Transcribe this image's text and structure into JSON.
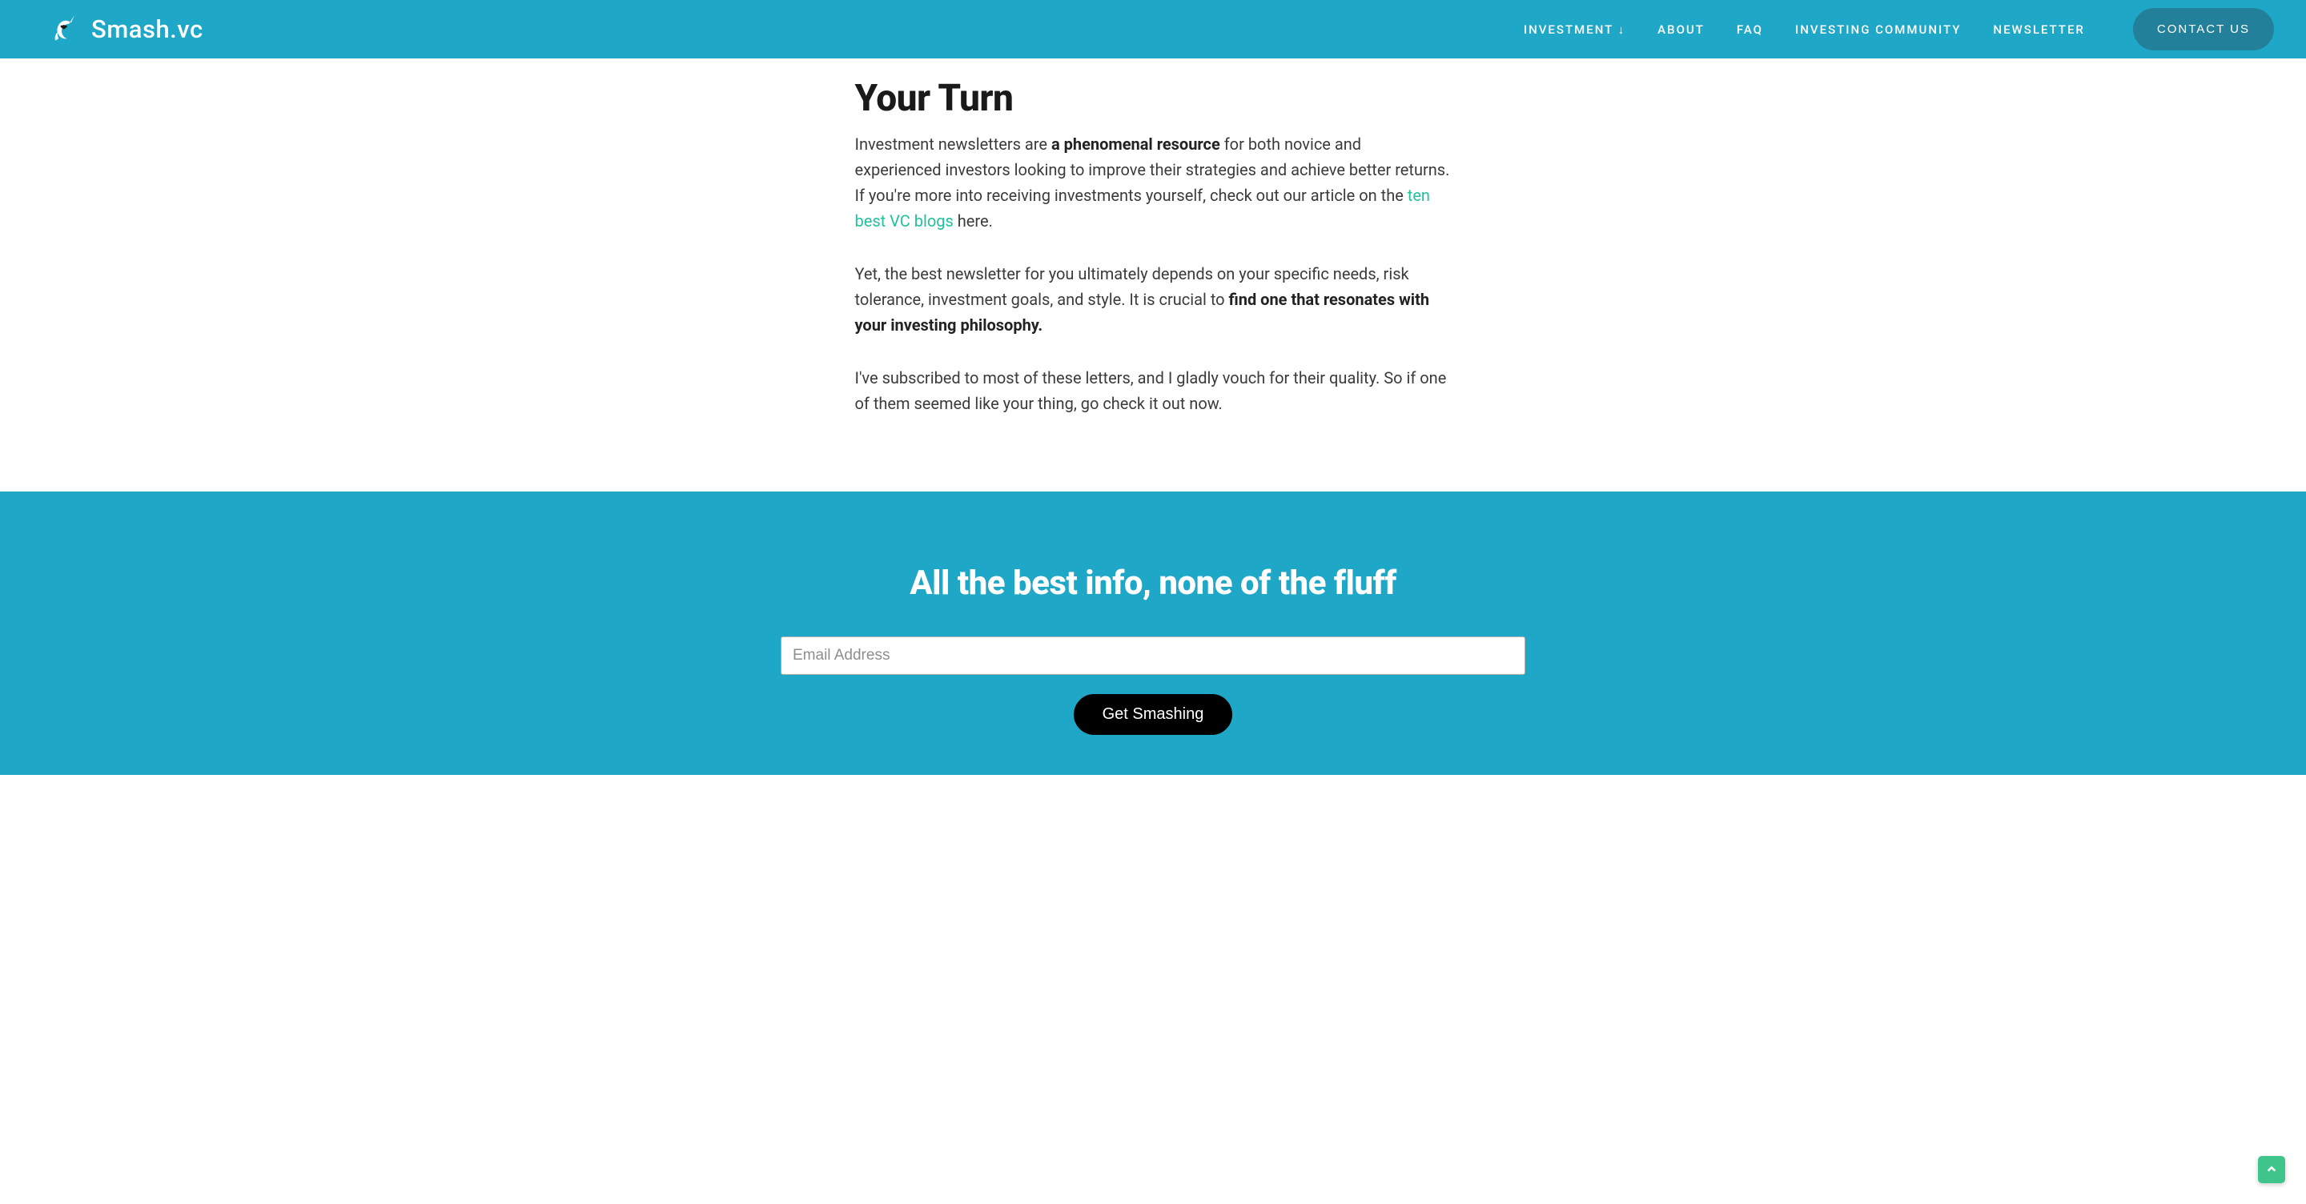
{
  "brand": {
    "name": "Smash.vc"
  },
  "nav": {
    "items": [
      "INVESTMENT ↓",
      "ABOUT",
      "FAQ",
      "INVESTING COMMUNITY",
      "NEWSLETTER"
    ],
    "contact": "CONTACT US"
  },
  "article": {
    "heading": "Your Turn",
    "p1_a": "Investment newsletters are ",
    "p1_strong": "a phenomenal resource",
    "p1_b": " for both novice and experienced investors looking to improve their strategies and achieve better returns. If you're more into receiving investments yourself, check out our article on the ",
    "p1_link": "ten best VC blogs",
    "p1_c": " here.",
    "p2_a": "Yet, the best newsletter for you ultimately depends on your specific needs, risk tolerance, investment goals, and style. It is crucial to ",
    "p2_strong": "find one that resonates with your investing philosophy.",
    "p3": "I've subscribed to most of these letters, and I gladly vouch for their quality. So if one of them seemed like your thing, go check it out now."
  },
  "cta": {
    "heading": "All the best info, none of the fluff",
    "email_placeholder": "Email Address",
    "submit": "Get Smashing"
  }
}
